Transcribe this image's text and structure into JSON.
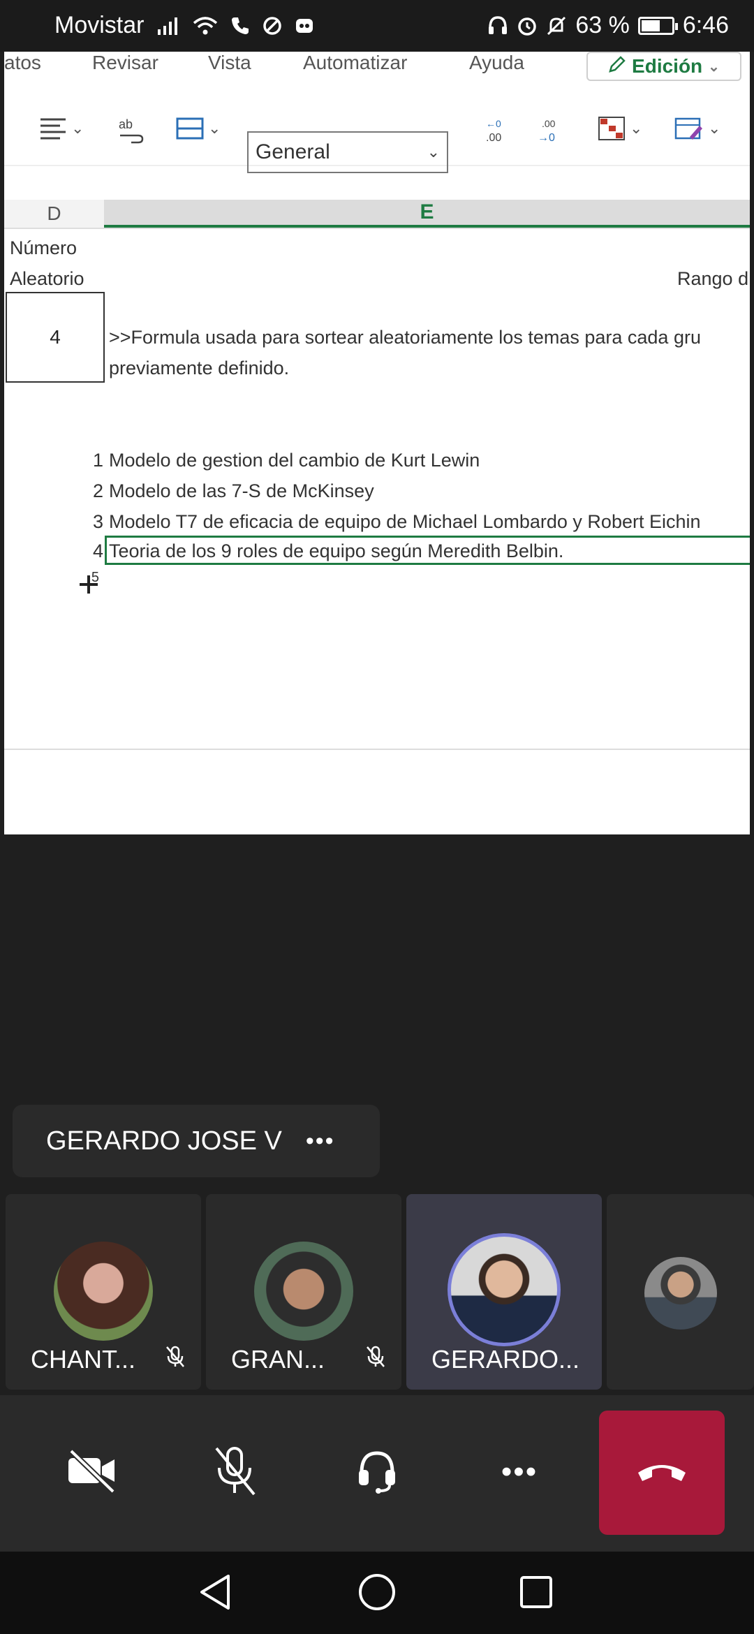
{
  "status_bar": {
    "carrier": "Movistar",
    "battery": "63 %",
    "battery_level": 0.63,
    "time": "6:46"
  },
  "shared_screen": {
    "ribbon_tabs": [
      "atos",
      "Revisar",
      "Vista",
      "Automatizar",
      "Ayuda"
    ],
    "edit_mode_label": "Edición",
    "number_format": "General",
    "column_d": "D",
    "column_e": "E",
    "header_line1": "Número",
    "header_line2": "Aleatorio",
    "header_e_right": "Rango d",
    "random_value": "4",
    "formula_note_line1": ">>Formula usada para sortear aleatoriamente los temas para cada gru",
    "formula_note_line2": "previamente definido.",
    "topics": [
      {
        "num": "1",
        "label": "Modelo de gestion del cambio de Kurt Lewin"
      },
      {
        "num": "2",
        "label": "Modelo de las 7-S de McKinsey"
      },
      {
        "num": "3",
        "label": "Modelo T7 de eficacia de equipo de Michael Lombardo y Robert Eichin"
      },
      {
        "num": "4",
        "label": "Teoria de los 9 roles de equipo según Meredith Belbin."
      }
    ],
    "next_row_num": "5"
  },
  "speaker_chip": {
    "name": "GERARDO JOSE V",
    "more_label": "•••"
  },
  "participants": [
    {
      "name": "CHANT...",
      "muted": true,
      "active": false
    },
    {
      "name": "GRAN...",
      "muted": true,
      "active": false
    },
    {
      "name": "GERARDO...",
      "muted": false,
      "active": true
    },
    {
      "name": "",
      "muted": false,
      "active": false
    }
  ],
  "controls": {
    "more_label": "•••"
  },
  "colors": {
    "accent_green": "#1e7b42",
    "hangup_red": "#a8193a",
    "active_ring": "#7b7fd8"
  }
}
